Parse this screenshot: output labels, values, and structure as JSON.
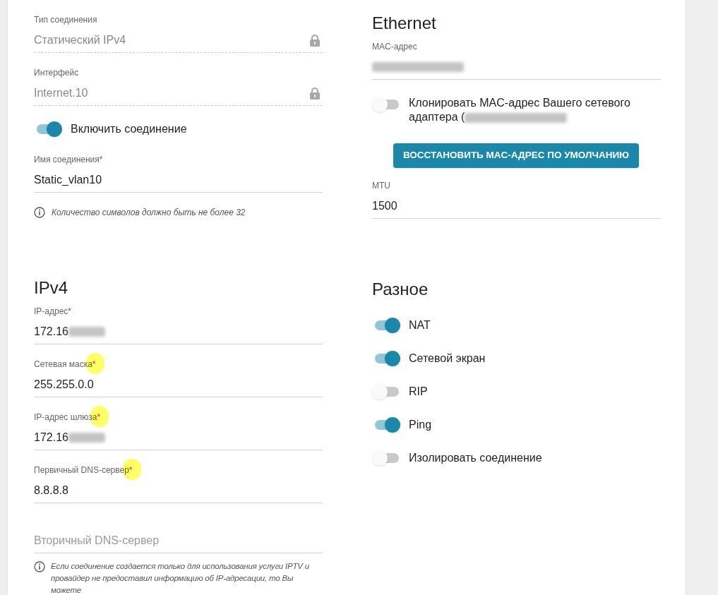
{
  "connection": {
    "fields": [
      {
        "label": "Тип соединения",
        "value": "Статический IPv4",
        "locked": true
      },
      {
        "label": "Интерфейс",
        "value": "Internet.10",
        "locked": true
      }
    ],
    "enable_toggle": {
      "label": "Включить соединение",
      "on": true
    },
    "name_field": {
      "label": "Имя соединения",
      "required_mark": "*",
      "value": "Static_vlan10"
    },
    "name_hint": "Количество символов должно быть не более 32"
  },
  "ipv4": {
    "title": "IPv4",
    "fields": [
      {
        "label": "IP-адрес",
        "required_mark": "*",
        "value": "172.16",
        "redacted": true,
        "highlighted": false
      },
      {
        "label": "Сетевая маска",
        "required_mark": "*",
        "value": "255.255.0.0",
        "redacted": false,
        "highlighted": true
      },
      {
        "label": "IP-адрес шлюза",
        "required_mark": "*",
        "value": "172.16",
        "redacted": true,
        "highlighted": true
      },
      {
        "label": "Первичный DNS-сервер",
        "required_mark": "*",
        "value": "8.8.8.8",
        "redacted": false,
        "highlighted": true
      }
    ],
    "secondary_dns": {
      "placeholder": "Вторичный DNS-сервер"
    },
    "note": "Если соединение создается только для использования услуги IPTV и провайдер не предоставил информацию об IP-адресации, то Вы можете"
  },
  "ethernet": {
    "title": "Ethernet",
    "mac_field": {
      "label": "MAC-адрес",
      "redacted": true
    },
    "clone_toggle": {
      "label": "Клонировать MAC-адрес Вашего сетевого адаптера (",
      "on": false,
      "redacted": true
    },
    "restore_button": "ВОССТАНОВИТЬ MAC-АДРЕС ПО УМОЛЧАНИЮ",
    "mtu_field": {
      "label": "MTU",
      "value": "1500"
    }
  },
  "misc": {
    "title": "Разное",
    "toggles": [
      {
        "label": "NAT",
        "on": true
      },
      {
        "label": "Сетевой экран",
        "on": true
      },
      {
        "label": "RIP",
        "on": false
      },
      {
        "label": "Ping",
        "on": true
      },
      {
        "label": "Изолировать соединение",
        "on": false
      }
    ]
  }
}
